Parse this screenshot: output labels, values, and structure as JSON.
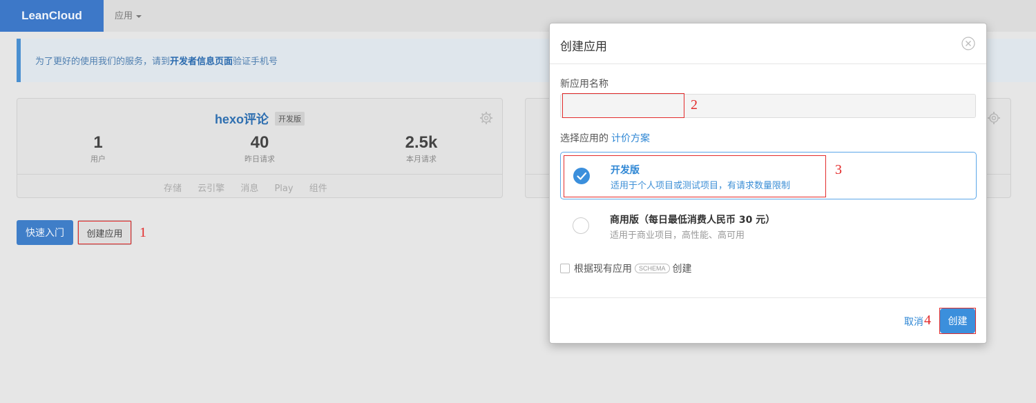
{
  "header": {
    "brand": "LeanCloud",
    "nav_apps": "应用"
  },
  "notice": {
    "prefix": "为了更好的使用我们的服务，请到",
    "link": "开发者信息页面",
    "suffix": "验证手机号"
  },
  "app_card": {
    "name": "hexo评论",
    "badge": "开发版",
    "stats": [
      {
        "value": "1",
        "label": "用户"
      },
      {
        "value": "40",
        "label": "昨日请求"
      },
      {
        "value": "2.5k",
        "label": "本月请求"
      }
    ],
    "tabs": [
      "存储",
      "云引擎",
      "消息",
      "Play",
      "组件"
    ]
  },
  "actions": {
    "quick_start": "快速入门",
    "create_app": "创建应用"
  },
  "annotations": [
    "1",
    "2",
    "3",
    "4"
  ],
  "modal": {
    "title": "创建应用",
    "name_label": "新应用名称",
    "name_value": "",
    "plan_label": "选择应用的",
    "plan_link": "计价方案",
    "plans": [
      {
        "name": "开发版",
        "desc": "适用于个人项目或测试项目，有请求数量限制",
        "selected": true
      },
      {
        "name": "商用版（每日最低消费人民币 30 元）",
        "desc": "适用于商业项目，高性能、高可用",
        "selected": false
      }
    ],
    "schema_prefix": "根据现有应用",
    "schema_tag": "SCHEMA",
    "schema_suffix": "创建",
    "cancel": "取消",
    "create": "创建"
  },
  "colors": {
    "primary": "#3b8fdc",
    "annotation": "#e32a2a",
    "brand": "#3d78c8"
  }
}
